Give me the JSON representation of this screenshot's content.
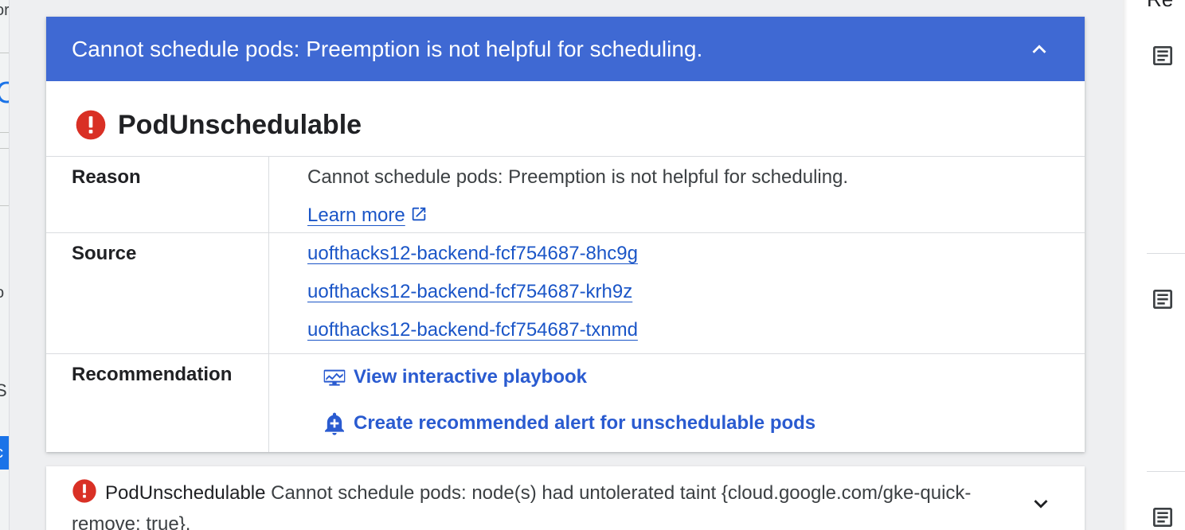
{
  "left_fragments": [
    "or",
    "C",
    "o",
    "S",
    "c"
  ],
  "right_panel": {
    "title_fragment": "Re",
    "icons": [
      "document-icon",
      "document-icon",
      "document-icon"
    ]
  },
  "expanded_card": {
    "header_text": "Cannot schedule pods: Preemption is not helpful for scheduling.",
    "header_toggle_icon": "chevron-up-icon",
    "title": "PodUnschedulable",
    "title_icon": "error-icon",
    "reason": {
      "label": "Reason",
      "value": "Cannot schedule pods: Preemption is not helpful for scheduling.",
      "learn_more": "Learn more",
      "learn_more_icon": "open-in-new-icon"
    },
    "source": {
      "label": "Source",
      "links": [
        "uofthacks12-backend-fcf754687-8hc9g",
        "uofthacks12-backend-fcf754687-krh9z",
        "uofthacks12-backend-fcf754687-txnmd"
      ]
    },
    "recommendation": {
      "label": "Recommendation",
      "actions": [
        {
          "label": "View interactive playbook",
          "icon": "monitoring-icon"
        },
        {
          "label": "Create recommended alert for unschedulable pods",
          "icon": "add-alert-icon"
        }
      ]
    }
  },
  "collapsed_card": {
    "title": "PodUnschedulable",
    "message": "Cannot schedule pods: node(s) had untolerated taint {cloud.google.com/gke-quick-remove: true}.",
    "icon": "error-icon",
    "toggle_icon": "chevron-down-icon"
  },
  "colors": {
    "header_bg": "#3f69d3",
    "link": "#1a55c7",
    "error": "#d93025"
  }
}
